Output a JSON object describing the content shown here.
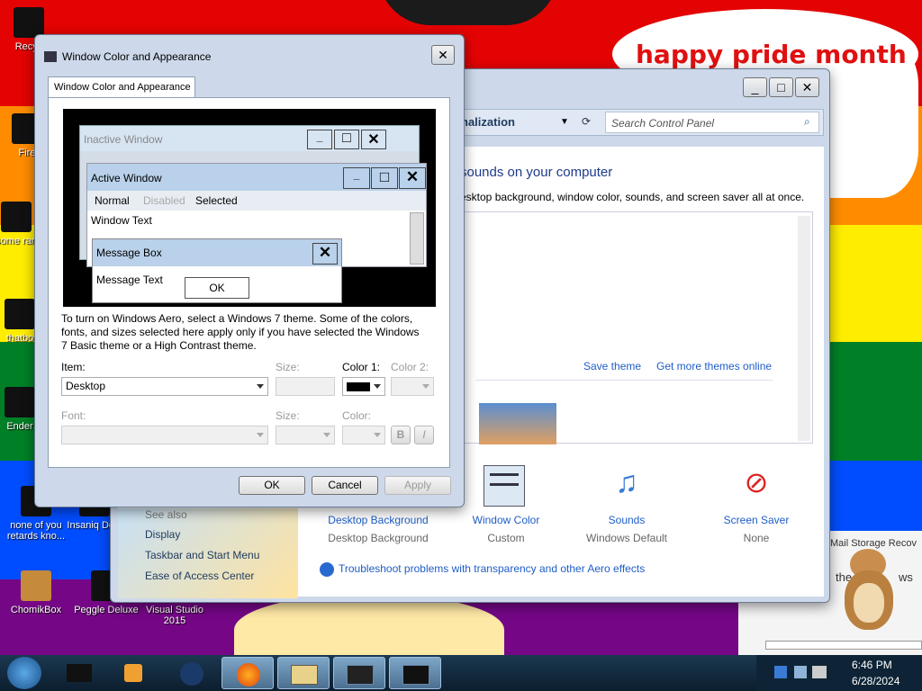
{
  "desktop": {
    "banner_text": "happy pride month",
    "icons": [
      {
        "label": "Recyc"
      },
      {
        "label": "Fire"
      },
      {
        "label": "some ran"
      },
      {
        "label": "thatbo"
      },
      {
        "label": "Ender"
      },
      {
        "label": "none of you retards kno..."
      },
      {
        "label": "Insaniq Delu"
      },
      {
        "label": "ChomikBox"
      },
      {
        "label": "Peggle Deluxe"
      },
      {
        "label": "Visual Studio 2015"
      }
    ],
    "mail_storage_text": "Mail Storage Recov",
    "background_text": "the",
    "background_text2": "ws"
  },
  "control_panel": {
    "breadcrumb": "nalization",
    "search_placeholder": "Search Control Panel",
    "heading": "sounds on your computer",
    "description": "esktop background, window color, sounds, and screen saver all at once.",
    "save_theme": "Save theme",
    "get_more_themes": "Get more themes online",
    "see_also": "See also",
    "sidebar_links": [
      "Display",
      "Taskbar and Start Menu",
      "Ease of Access Center"
    ],
    "bottom_items": [
      {
        "title": "Desktop Background",
        "sub": "Desktop Background",
        "icon": "desktop-background-icon"
      },
      {
        "title": "Window Color",
        "sub": "Custom",
        "icon": "window-color-icon"
      },
      {
        "title": "Sounds",
        "sub": "Windows Default",
        "icon": "sounds-icon"
      },
      {
        "title": "Screen Saver",
        "sub": "None",
        "icon": "screen-saver-icon"
      }
    ],
    "troubleshoot": "Troubleshoot problems with transparency and other Aero effects"
  },
  "dialog": {
    "title": "Window Color and Appearance",
    "tab": "Window Color and Appearance",
    "preview": {
      "inactive_title": "Inactive Window",
      "active_title": "Active Window",
      "menu_normal": "Normal",
      "menu_disabled": "Disabled",
      "menu_selected": "Selected",
      "window_text": "Window Text",
      "msgbox_title": "Message Box",
      "msgbox_text": "Message Text",
      "msgbox_ok": "OK"
    },
    "info_text": "To turn on Windows Aero, select a Windows 7 theme.  Some of the colors, fonts, and sizes selected here apply only if you have selected the Windows 7 Basic theme or a High Contrast theme.",
    "item_label": "Item:",
    "item_value": "Desktop",
    "size_label": "Size:",
    "color1_label": "Color 1:",
    "color2_label": "Color 2:",
    "font_label": "Font:",
    "font_size_label": "Size:",
    "font_color_label": "Color:",
    "bold_label": "B",
    "italic_label": "I",
    "ok": "OK",
    "cancel": "Cancel",
    "apply": "Apply",
    "color1_value": "#000000"
  },
  "taskbar": {
    "time": "6:46 PM",
    "date": "6/28/2024"
  },
  "colors": {
    "accent_link": "#1f5dc8",
    "active_caption": "#b9d1ea",
    "inactive_caption": "#d7e4f2"
  }
}
